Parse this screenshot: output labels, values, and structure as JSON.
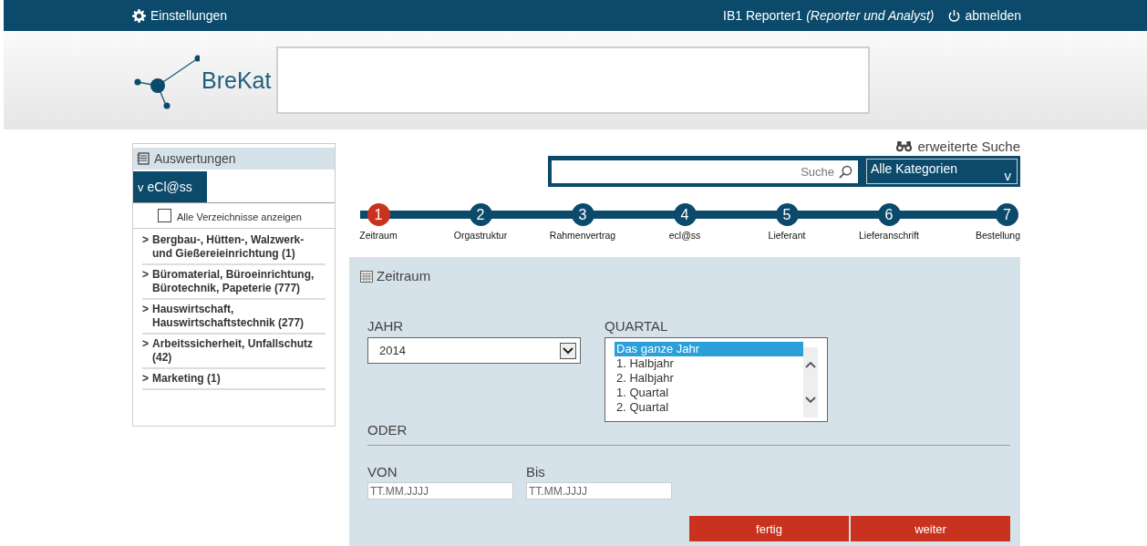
{
  "top_bar": {
    "settings": "Einstellungen",
    "user": "IB1 Reporter1",
    "role": "(Reporter und Analyst)",
    "logout": "abmelden"
  },
  "logo": {
    "text": "BreKat"
  },
  "sidebar": {
    "title": "Auswertungen",
    "tab": "eCl@ss",
    "tab_caret": "v",
    "show_all": {
      "label": "Alle Verzeichnisse anzeigen",
      "checked": false
    },
    "items": [
      {
        "marker": ">",
        "label": "Bergbau-, Hütten-, Walzwerk- und Gießereieinrichtung (1)"
      },
      {
        "marker": ">",
        "label": "Büromaterial, Büroeinrichtung, Bürotechnik, Papeterie (777)"
      },
      {
        "marker": ">",
        "label": "Hauswirtschaft, Hauswirtschaftstechnik (277)"
      },
      {
        "marker": ">",
        "label": "Arbeitssicherheit, Unfallschutz (42)"
      },
      {
        "marker": ">",
        "label": "Marketing (1)"
      }
    ]
  },
  "search": {
    "advanced": "erweiterte Suche",
    "placeholder": "Suche",
    "category": "Alle Kategorien",
    "category_caret": "v"
  },
  "steps": [
    {
      "number": "1",
      "label": "Zeitraum",
      "selected": true
    },
    {
      "number": "2",
      "label": "Orgastruktur",
      "selected": false
    },
    {
      "number": "3",
      "label": "Rahmenvertrag",
      "selected": false
    },
    {
      "number": "4",
      "label": "ecl@ss",
      "selected": false
    },
    {
      "number": "5",
      "label": "Lieferant",
      "selected": false
    },
    {
      "number": "6",
      "label": "Lieferanschrift",
      "selected": false
    },
    {
      "number": "7",
      "label": "Bestellung",
      "selected": false
    }
  ],
  "panel": {
    "title": "Zeitraum",
    "year_label": "JAHR",
    "year_value": "2014",
    "quarter_label": "QUARTAL",
    "quarter_options": [
      {
        "label": "Das ganze Jahr",
        "selected": true
      },
      {
        "label": "1. Halbjahr",
        "selected": false
      },
      {
        "label": "2. Halbjahr",
        "selected": false
      },
      {
        "label": "1. Quartal",
        "selected": false
      },
      {
        "label": "2. Quartal",
        "selected": false
      }
    ],
    "or_label": "ODER",
    "from_label": "VON",
    "from_placeholder": "TT.MM.JJJJ",
    "to_label": "Bis",
    "to_placeholder": "TT.MM.JJJJ",
    "buttons": [
      "fertig",
      "weiter"
    ]
  }
}
